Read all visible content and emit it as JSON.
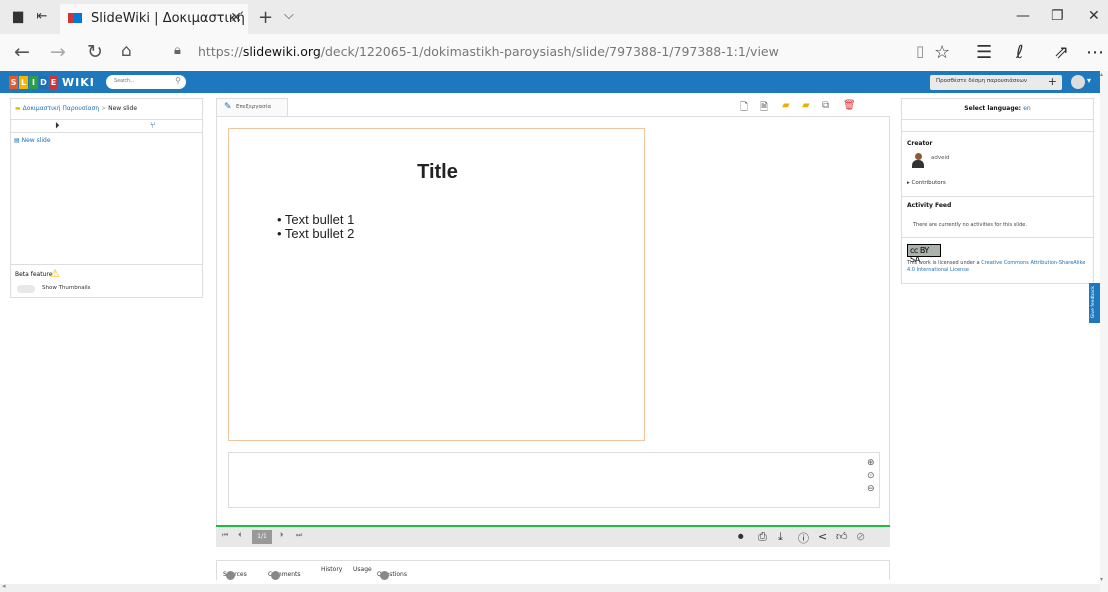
{
  "browser": {
    "tab_title": "SlideWiki | Δοκιμαστική",
    "tab_close": "✕",
    "new_tab": "+",
    "tab_list": "⌵",
    "url_prefix": "https://",
    "url_host": "slidewiki.org",
    "url_path": "/deck/122065-1/dokimastikh-paroysiash/slide/797388-1/797388-1:1/view"
  },
  "nav": {
    "logo_letters": [
      "S",
      "L",
      "I",
      "D",
      "E"
    ],
    "logo_colors": [
      "#e45b2b",
      "#f7b500",
      "#2e9e44",
      "#1e6fb5",
      "#d13438"
    ],
    "logo_wiki": "WIKI",
    "search_placeholder": "Search...",
    "add_deck": "Προσθέστε δέσμη παρουσιάσεων",
    "add_plus": "+"
  },
  "left": {
    "crumb_deck": "Δοκιμαστική Παρουσίαση",
    "crumb_sep": ">",
    "crumb_current": "New slide",
    "tree_item": "New slide",
    "beta_label": "Beta feature",
    "thumbs_label": "Show Thumbnails"
  },
  "center": {
    "edit_label": "Επεξεργασία",
    "slide_title": "Title",
    "bullets": [
      "• Text bullet 1",
      "• Text bullet 2"
    ],
    "page": "1/1"
  },
  "info_tabs": {
    "sources": "Sources",
    "comments": "Comments",
    "history": "History",
    "usage": "Usage",
    "questions": "Questions"
  },
  "right": {
    "select_language": "Select language:",
    "language": "en",
    "creator_heading": "Creator",
    "creator_name": "adveid",
    "contributors": "Contributors",
    "activity_heading": "Activity Feed",
    "activity_text": "There are currently no activities for this slide.",
    "cc_badge": "cc BY SA",
    "license_prefix": "This work is licensed under a ",
    "license_link": "Creative Commons Attribution-ShareAlike 4.0 International License",
    "feedback": "Give feedback"
  }
}
